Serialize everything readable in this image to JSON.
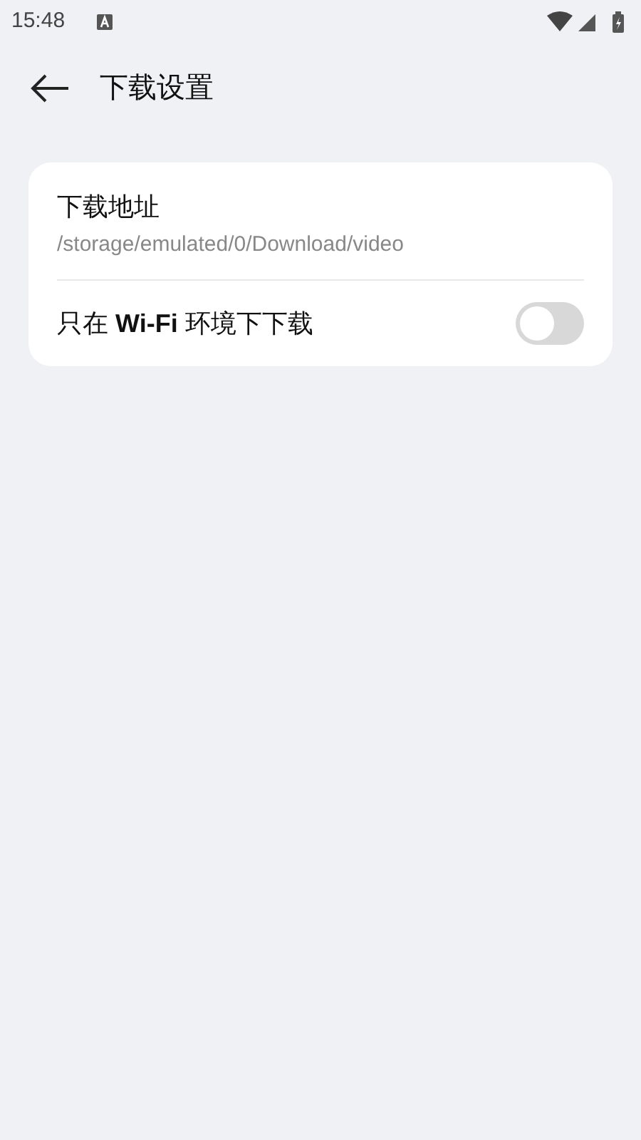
{
  "status_bar": {
    "time": "15:48"
  },
  "header": {
    "title": "下载设置"
  },
  "settings": [
    {
      "kind": "path",
      "title": "下载地址",
      "value": "/storage/emulated/0/Download/video"
    },
    {
      "kind": "toggle",
      "title": "只在 **Wi-Fi** 环境下下载",
      "on": false
    }
  ]
}
